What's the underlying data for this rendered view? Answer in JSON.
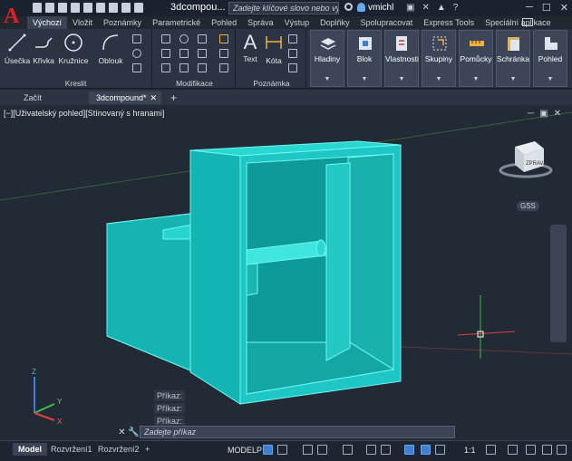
{
  "app": {
    "logo_letter": "A",
    "file_title": "3dcompou...",
    "search_placeholder": "Zadejte klíčové slovo nebo výraz.",
    "user": "vmichl",
    "help": "?"
  },
  "ribbon_tabs": [
    "Výchozí",
    "Vložit",
    "Poznámky",
    "Parametrické",
    "Pohled",
    "Správa",
    "Výstup",
    "Doplňky",
    "Spolupracovat",
    "Express Tools",
    "Speciální aplikace"
  ],
  "ribbon": {
    "draw": {
      "label": "Kreslit",
      "buttons": [
        "Úsečka",
        "Křivka",
        "Kružnice",
        "Oblouk"
      ]
    },
    "modify": {
      "label": "Modifikace"
    },
    "annotation": {
      "label": "Poznámka",
      "buttons": [
        "Text",
        "Kóta"
      ]
    },
    "right_buttons": [
      "Hladiny",
      "Blok",
      "Vlastnosti",
      "Skupiny",
      "Pomůcky",
      "Schránka",
      "Pohled"
    ]
  },
  "doc_tabs": [
    "Začít",
    "3dcompound*"
  ],
  "viewport": {
    "label": "[−][Uživatelský pohled][Stínovaný s hranami]",
    "viewcube_face": "ZPRAVA",
    "wcs_label": "GSS",
    "command_history": [
      "Příkaz:",
      "Příkaz:",
      "Příkaz:"
    ],
    "ucs_x": "X",
    "ucs_y": "Y",
    "ucs_z": "Z"
  },
  "command_line": {
    "placeholder": "Zadejte příkaz"
  },
  "status": {
    "layout_tabs": [
      "Model",
      "Rozvržení1",
      "Rozvržení2"
    ],
    "model_label": "MODELP",
    "scale": "1:1"
  },
  "colors": {
    "solid": "#1ec3c3",
    "solid_dark": "#12a4a4",
    "edge": "#5ff5ef",
    "accent": "#3f7fd1"
  }
}
